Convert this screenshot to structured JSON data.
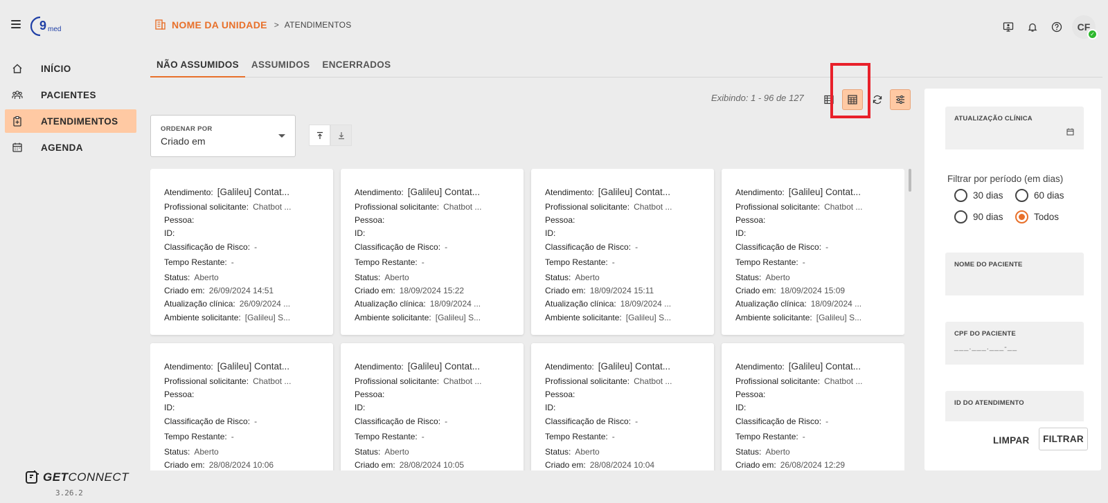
{
  "app": {
    "version": "3.26.2",
    "brand_logo": "9med",
    "footer_brand_bold": "GET",
    "footer_brand_rest": "CONNECT"
  },
  "nav": [
    {
      "label": "INÍCIO",
      "icon": "home-icon"
    },
    {
      "label": "PACIENTES",
      "icon": "patients-icon"
    },
    {
      "label": "ATENDIMENTOS",
      "icon": "clipboard-icon"
    },
    {
      "label": "AGENDA",
      "icon": "calendar-icon"
    }
  ],
  "header": {
    "unit": "NOME DA UNIDADE",
    "separator": ">",
    "page": "ATENDIMENTOS",
    "avatar_initials": "CF"
  },
  "tabs": [
    "NÃO ASSUMIDOS",
    "ASSUMIDOS",
    "ENCERRADOS"
  ],
  "toolbar": {
    "count": "Exibindo: 1 - 96 de 127"
  },
  "sort": {
    "label": "ORDENAR POR",
    "value": "Criado em"
  },
  "labels": {
    "atendimento": "Atendimento:",
    "profissional": "Profissional solicitante:",
    "pessoa": "Pessoa:",
    "id": "ID:",
    "classificacao": "Classificação de Risco:",
    "tempo": "Tempo Restante:",
    "status": "Status:",
    "criado": "Criado em:",
    "atualizacao": "Atualização clínica:",
    "ambiente": "Ambiente solicitante:"
  },
  "cards": [
    {
      "atendimento": "[Galileu] Contat...",
      "profissional": "Chatbot ...",
      "pessoa": "",
      "id": "",
      "classificacao": "-",
      "tempo": "-",
      "status": "Aberto",
      "criado": "26/09/2024 14:51",
      "atualizacao": "26/09/2024 ...",
      "ambiente": "[Galileu] S..."
    },
    {
      "atendimento": "[Galileu] Contat...",
      "profissional": "Chatbot ...",
      "pessoa": "",
      "id": "",
      "classificacao": "-",
      "tempo": "-",
      "status": "Aberto",
      "criado": "18/09/2024 15:22",
      "atualizacao": "18/09/2024 ...",
      "ambiente": "[Galileu] S..."
    },
    {
      "atendimento": "[Galileu] Contat...",
      "profissional": "Chatbot ...",
      "pessoa": "",
      "id": "",
      "classificacao": "-",
      "tempo": "-",
      "status": "Aberto",
      "criado": "18/09/2024 15:11",
      "atualizacao": "18/09/2024 ...",
      "ambiente": "[Galileu] S..."
    },
    {
      "atendimento": "[Galileu] Contat...",
      "profissional": "Chatbot ...",
      "pessoa": "",
      "id": "",
      "classificacao": "-",
      "tempo": "-",
      "status": "Aberto",
      "criado": "18/09/2024 15:09",
      "atualizacao": "18/09/2024 ...",
      "ambiente": "[Galileu] S..."
    },
    {
      "atendimento": "[Galileu] Contat...",
      "profissional": "Chatbot ...",
      "pessoa": "",
      "id": "",
      "classificacao": "-",
      "tempo": "-",
      "status": "Aberto",
      "criado": "28/08/2024 10:06"
    },
    {
      "atendimento": "[Galileu] Contat...",
      "profissional": "Chatbot ...",
      "pessoa": "",
      "id": "",
      "classificacao": "-",
      "tempo": "-",
      "status": "Aberto",
      "criado": "28/08/2024 10:05"
    },
    {
      "atendimento": "[Galileu] Contat...",
      "profissional": "Chatbot ...",
      "pessoa": "",
      "id": "",
      "classificacao": "-",
      "tempo": "-",
      "status": "Aberto",
      "criado": "28/08/2024 10:04"
    },
    {
      "atendimento": "[Galileu] Contat...",
      "profissional": "Chatbot ...",
      "pessoa": "",
      "id": "",
      "classificacao": "-",
      "tempo": "-",
      "status": "Aberto",
      "criado": "26/08/2024 12:29"
    }
  ],
  "filters": {
    "atualizacao_label": "ATUALIZAÇÃO CLÍNICA",
    "period_title": "Filtrar por período (em dias)",
    "periods": [
      "30 dias",
      "60 dias",
      "90 dias",
      "Todos"
    ],
    "selected_period": "Todos",
    "nome_label": "NOME DO PACIENTE",
    "cpf_label": "CPF DO PACIENTE",
    "cpf_placeholder": "___.___.___-__",
    "id_label": "ID DO ATENDIMENTO",
    "limpar": "LIMPAR",
    "filtrar": "FILTRAR"
  },
  "colors": {
    "accent": "#e8702a",
    "active_bg": "#ffc9a3",
    "highlight_box": "#e8202a",
    "online": "#2eb82e"
  }
}
